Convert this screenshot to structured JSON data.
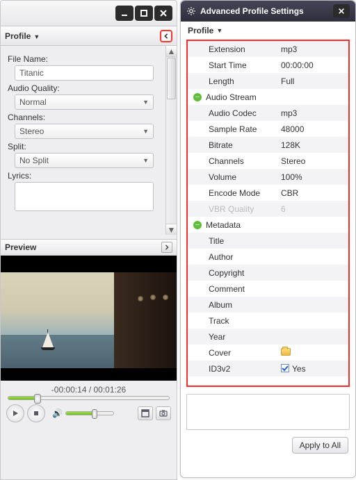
{
  "window": {
    "minimize_tip": "Minimize",
    "maximize_tip": "Maximize",
    "close_tip": "Close"
  },
  "left": {
    "profile_header": "Profile",
    "labels": {
      "file_name": "File Name:",
      "audio_quality": "Audio Quality:",
      "channels": "Channels:",
      "split": "Split:",
      "lyrics": "Lyrics:"
    },
    "values": {
      "file_name": "Titanic",
      "audio_quality": "Normal",
      "channels": "Stereo",
      "split": "No Split",
      "lyrics": ""
    },
    "preview_header": "Preview",
    "time_text": "-00:00:14 / 00:01:26"
  },
  "right": {
    "title": "Advanced Profile Settings",
    "sub": "Profile",
    "rows": [
      {
        "type": "row",
        "k": "Extension",
        "v": "mp3",
        "alt": true
      },
      {
        "type": "row",
        "k": "Start Time",
        "v": "00:00:00",
        "alt": false
      },
      {
        "type": "row",
        "k": "Length",
        "v": "Full",
        "alt": true
      },
      {
        "type": "group",
        "k": "Audio Stream",
        "alt": false
      },
      {
        "type": "row",
        "k": "Audio Codec",
        "v": "mp3",
        "alt": true
      },
      {
        "type": "row",
        "k": "Sample Rate",
        "v": "48000",
        "alt": false
      },
      {
        "type": "row",
        "k": "Bitrate",
        "v": "128K",
        "alt": true
      },
      {
        "type": "row",
        "k": "Channels",
        "v": "Stereo",
        "alt": false
      },
      {
        "type": "row",
        "k": "Volume",
        "v": "100%",
        "alt": true
      },
      {
        "type": "row",
        "k": "Encode Mode",
        "v": "CBR",
        "alt": false
      },
      {
        "type": "row",
        "k": "VBR Quality",
        "v": "6",
        "alt": true,
        "disabled": true
      },
      {
        "type": "group",
        "k": "Metadata",
        "alt": false
      },
      {
        "type": "row",
        "k": "Title",
        "v": "",
        "alt": true
      },
      {
        "type": "row",
        "k": "Author",
        "v": "",
        "alt": false
      },
      {
        "type": "row",
        "k": "Copyright",
        "v": "",
        "alt": true
      },
      {
        "type": "row",
        "k": "Comment",
        "v": "",
        "alt": false
      },
      {
        "type": "row",
        "k": "Album",
        "v": "",
        "alt": true
      },
      {
        "type": "row",
        "k": "Track",
        "v": "",
        "alt": false
      },
      {
        "type": "row",
        "k": "Year",
        "v": "",
        "alt": true
      },
      {
        "type": "row",
        "k": "Cover",
        "v": "__folder__",
        "alt": false
      },
      {
        "type": "row",
        "k": "ID3v2",
        "v": "__check__Yes",
        "alt": true
      }
    ],
    "apply_label": "Apply to All"
  }
}
